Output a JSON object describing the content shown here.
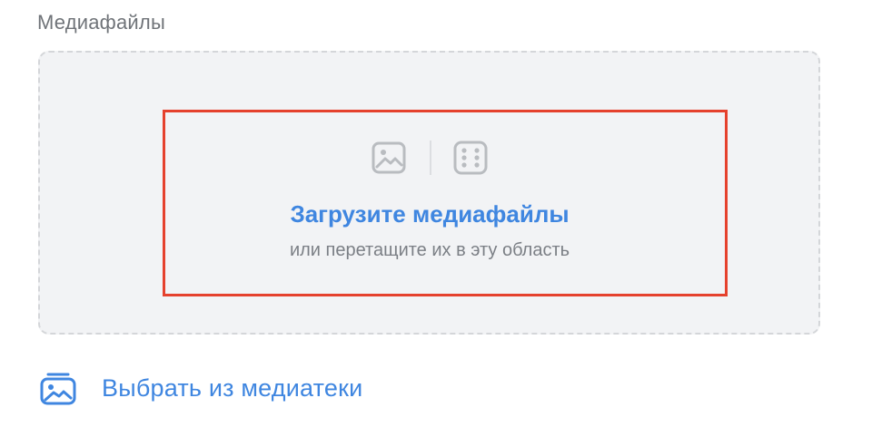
{
  "section": {
    "label": "Медиафайлы"
  },
  "dropzone": {
    "icons": [
      "image-icon",
      "dice-icon"
    ],
    "title": "Загрузите медиафайлы",
    "hint": "или перетащите их в эту область"
  },
  "library": {
    "icon": "media-library-icon",
    "label": "Выбрать из медиатеки"
  },
  "colors": {
    "accent": "#3f86e0",
    "highlight": "#e5412d",
    "dropzone_bg": "#f2f3f5",
    "icon_gray": "#b9bcc0",
    "label_gray": "#6f7378"
  }
}
